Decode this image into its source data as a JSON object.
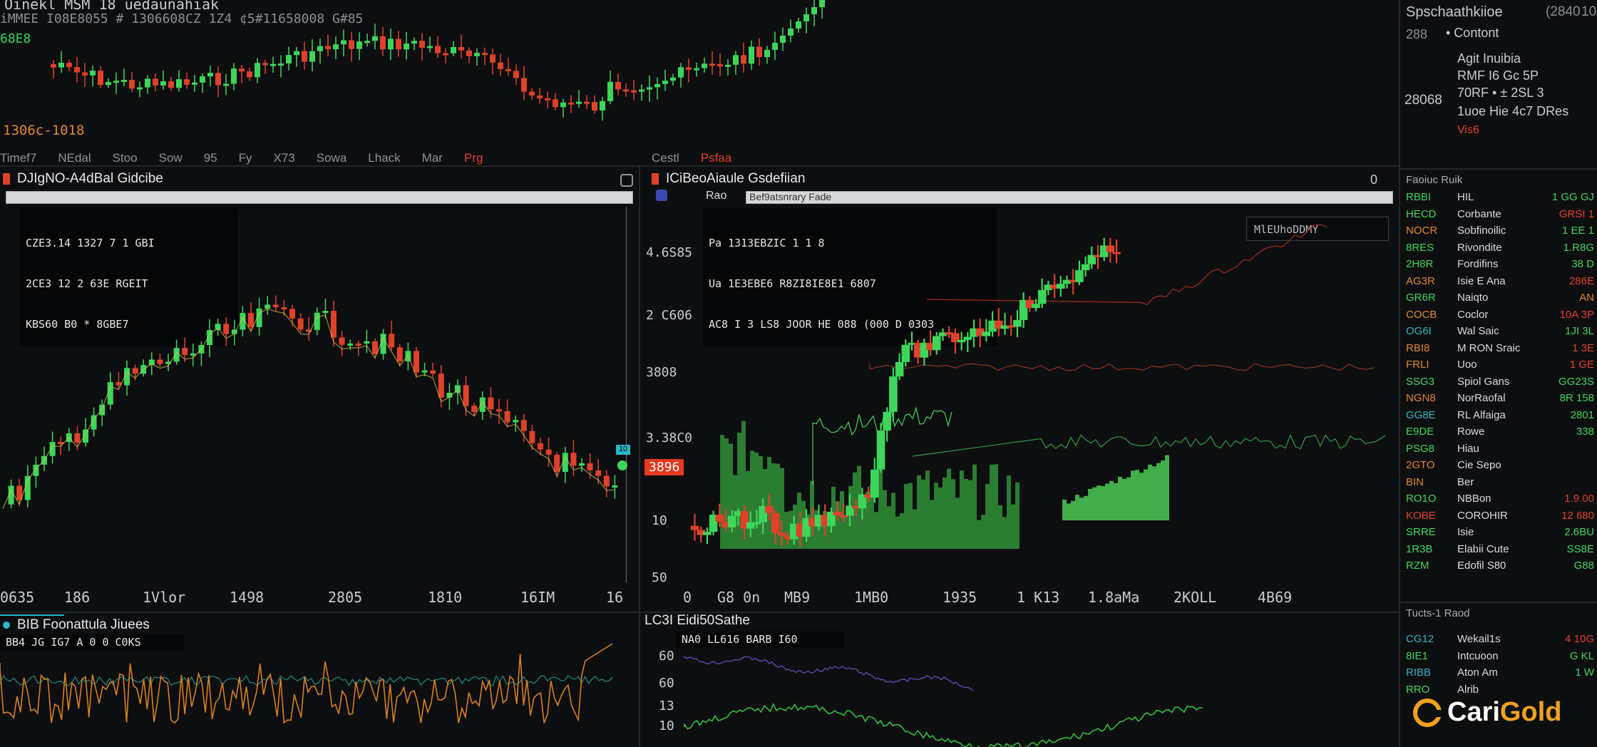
{
  "top": {
    "title": "Oinekl MSM 18 uedaunahiak",
    "ticker_line": "iMMEE  I08E8055 # 1306608CZ 1Z4  ¢5#11658008 G#85",
    "price_left": "68E8",
    "price_label": "1306c-1018",
    "tabs": [
      "Timef7",
      "NEdal",
      "Stoo",
      "Sow",
      "95",
      "Fy",
      "X73",
      "Sowa",
      "Lhack",
      "Mar",
      "Prg"
    ],
    "tabs2": [
      "Cestl",
      "Psfaa"
    ]
  },
  "right_top": {
    "title": "Spschaathkiioe",
    "year": "(2840",
    "hb": "10",
    "sub1": "• Contont",
    "sub2": "288",
    "lines": [
      "Agit Inuibia",
      "RMF I6 Gc 5P",
      "70RF • ± 2SL 3",
      "1uoe Hie 4c7 DRes"
    ],
    "side_value": "28068",
    "red_label": "Vis6"
  },
  "panel_left": {
    "title": "DJIgNO-A4dBal Gidcibe",
    "info": [
      "CZE3.14 1327 7 1 GBI",
      "2CE3 12 2 63E RGEIT",
      "KBS60 B0 * 8GBE7"
    ],
    "x_ticks": [
      "0635",
      "186",
      "1Vlor",
      "1498",
      "2805",
      "1810",
      "16IM",
      "16"
    ],
    "price_tag": "10",
    "tag_color": "#2ab8c4"
  },
  "panel_right": {
    "title": "ICiBeoAiaule Gsdefiian",
    "row_label": "Rao",
    "search_text": "Bef9atsnrary Fade",
    "info": [
      "Pa 1313EBZIC 1 1 8",
      "Ua 1E3EBE6 R8ZI8IE8E1 6807",
      "AC8 I 3 LS8 JOOR HE 088 (000 D 0303"
    ],
    "y_ticks": [
      "4.6S85",
      "2 C606",
      "3808",
      "3.38C0",
      "10",
      "50"
    ],
    "x_ticks": [
      "0",
      "G8 0n",
      "MB9",
      "1MB0",
      "1935",
      "1 K13",
      "1.8aMa",
      "2KOLL",
      "4B69"
    ],
    "price_badge": "3896",
    "legend_box": "MlEUhoDDMY"
  },
  "bottom_left": {
    "title": "BIB Foonattula Jiuees",
    "info": "BB4 JG IG7 A 0 0 C0KS"
  },
  "bottom_right": {
    "title": "LC3I Eidi50Sathe",
    "info": "NA0 LL616 BARB I60",
    "y_ticks": [
      "60",
      "60",
      "13",
      "10"
    ]
  },
  "sidebar": {
    "header": "Faoiuc Ruik",
    "rows": [
      {
        "sym": "RBBI",
        "name": "HIL",
        "val": "1 GG GJ",
        "sc": "#3cd65a",
        "vc": "#3cd65a"
      },
      {
        "sym": "HECD",
        "name": "Corbante",
        "val": "GRSI 1",
        "sc": "#3cd65a",
        "vc": "#e0412a"
      },
      {
        "sym": "NOCR",
        "name": "Sobfinoilic",
        "val": "1 EE 1",
        "sc": "#e0872a",
        "vc": "#3cd65a"
      },
      {
        "sym": "8RES",
        "name": "Rivondite",
        "val": "1.R8G",
        "sc": "#3cd65a",
        "vc": "#3cd65a"
      },
      {
        "sym": "2H8R",
        "name": "Fordifins",
        "val": "38 D",
        "sc": "#3cd65a",
        "vc": "#3cd65a"
      },
      {
        "sym": "AG3R",
        "name": "Isie E Ana",
        "val": "286E",
        "sc": "#e0872a",
        "vc": "#e0412a"
      },
      {
        "sym": "GR6R",
        "name": "Naiqto",
        "val": "AN",
        "sc": "#3cd65a",
        "vc": "#e0872a"
      },
      {
        "sym": "COCB",
        "name": "Coclor",
        "val": "10A 3P",
        "sc": "#e0872a",
        "vc": "#e0412a"
      },
      {
        "sym": "OG6I",
        "name": "Wal Saic",
        "val": "1JI 3L",
        "sc": "#2ab8c4",
        "vc": "#3cd65a"
      },
      {
        "sym": "RBI8",
        "name": "M RON Sraic",
        "val": "1 3E",
        "sc": "#e0872a",
        "vc": "#e0412a"
      },
      {
        "sym": "FRLI",
        "name": "Uoo",
        "val": "1 GE",
        "sc": "#e0872a",
        "vc": "#e0412a"
      },
      {
        "sym": "SSG3",
        "name": "Spiol Gans",
        "val": "GG23S",
        "sc": "#3cd65a",
        "vc": "#3cd65a"
      },
      {
        "sym": "NGN8",
        "name": "NorRaofal",
        "val": "8R 158",
        "sc": "#e0872a",
        "vc": "#3cd65a"
      },
      {
        "sym": "GG8E",
        "name": "RL Alfaiga",
        "val": "2801",
        "sc": "#2ab8c4",
        "vc": "#3cd65a"
      },
      {
        "sym": "E9DE",
        "name": "Rowe",
        "val": "338",
        "sc": "#3cd65a",
        "vc": "#3cd65a"
      },
      {
        "sym": "PSG8",
        "name": "Hiau",
        "val": "",
        "sc": "#3cd65a",
        "vc": "#3cd65a"
      },
      {
        "sym": "2GTO",
        "name": "Cie Sepo",
        "val": "",
        "sc": "#e0872a",
        "vc": "#e0412a"
      },
      {
        "sym": "BIN",
        "name": "Ber",
        "val": "",
        "sc": "#e0872a",
        "vc": "#e0412a"
      },
      {
        "sym": "RO1O",
        "name": "NBBon",
        "val": "1.9.00",
        "sc": "#3cd65a",
        "vc": "#e0412a"
      },
      {
        "sym": "KOBE",
        "name": "COROHIR",
        "val": "12 680",
        "sc": "#e0412a",
        "vc": "#e0412a"
      },
      {
        "sym": "SRRE",
        "name": "Isie",
        "val": "2.6BU",
        "sc": "#3cd65a",
        "vc": "#3cd65a"
      },
      {
        "sym": "1R3B",
        "name": "Elabii Cute",
        "val": "SS8E",
        "sc": "#3cd65a",
        "vc": "#3cd65a"
      },
      {
        "sym": "RZM",
        "name": "Edofil S80",
        "val": "G88",
        "sc": "#3cd65a",
        "vc": "#3cd65a"
      }
    ],
    "header2": "Tucts-1 Raod",
    "rows2": [
      {
        "sym": "CG12",
        "name": "Wekail1s",
        "val": "4 10G",
        "sc": "#2ab8c4",
        "vc": "#e0412a"
      },
      {
        "sym": "8IE1",
        "name": "Intcuoon",
        "val": "G KL",
        "sc": "#3cd65a",
        "vc": "#3cd65a"
      },
      {
        "sym": "RIBB",
        "name": "Aton Am",
        "val": "1 W",
        "sc": "#2ab8c4",
        "vc": "#3cd65a"
      },
      {
        "sym": "RRO",
        "name": "Alrib",
        "val": "",
        "sc": "#3cd65a",
        "vc": "#3cd65a"
      }
    ]
  },
  "logo": {
    "part1": "Cari",
    "part2": "Gold"
  }
}
